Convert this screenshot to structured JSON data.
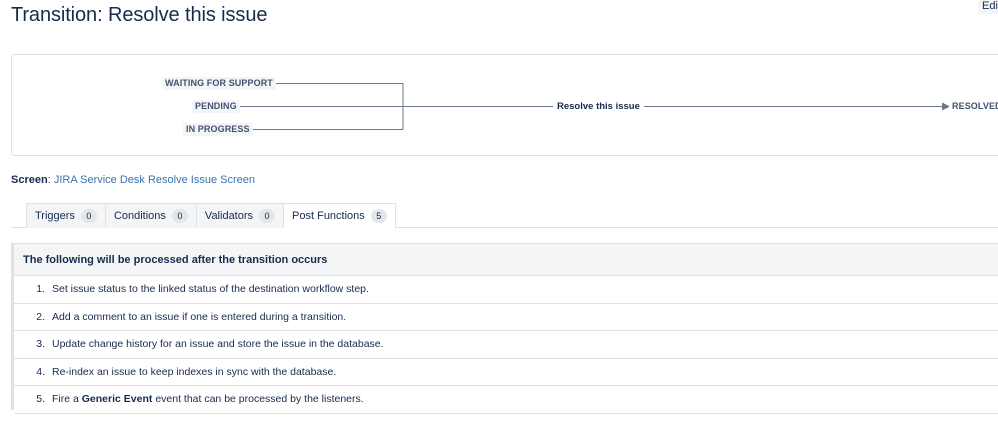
{
  "page": {
    "title": "Transition: Resolve this issue",
    "edit_label": "Edi"
  },
  "diagram": {
    "sources": [
      "WAITING FOR SUPPORT",
      "PENDING",
      "IN PROGRESS"
    ],
    "transition": "Resolve this issue",
    "destination": "RESOLVED"
  },
  "screen": {
    "label": "Screen",
    "link": "JIRA Service Desk Resolve Issue Screen"
  },
  "tabs": [
    {
      "label": "Triggers",
      "count": "0"
    },
    {
      "label": "Conditions",
      "count": "0"
    },
    {
      "label": "Validators",
      "count": "0"
    },
    {
      "label": "Post Functions",
      "count": "5",
      "active": true
    }
  ],
  "post_functions": {
    "heading": "The following will be processed after the transition occurs",
    "items": [
      {
        "num": "1.",
        "text": "Set issue status to the linked status of the destination workflow step."
      },
      {
        "num": "2.",
        "text": "Add a comment to an issue if one is entered during a transition."
      },
      {
        "num": "3.",
        "text": "Update change history for an issue and store the issue in the database."
      },
      {
        "num": "4.",
        "text": "Re-index an issue to keep indexes in sync with the database."
      },
      {
        "num": "5.",
        "pre": "Fire a",
        "bold": "Generic Event",
        "post": "event that can be processed by the listeners."
      }
    ]
  }
}
